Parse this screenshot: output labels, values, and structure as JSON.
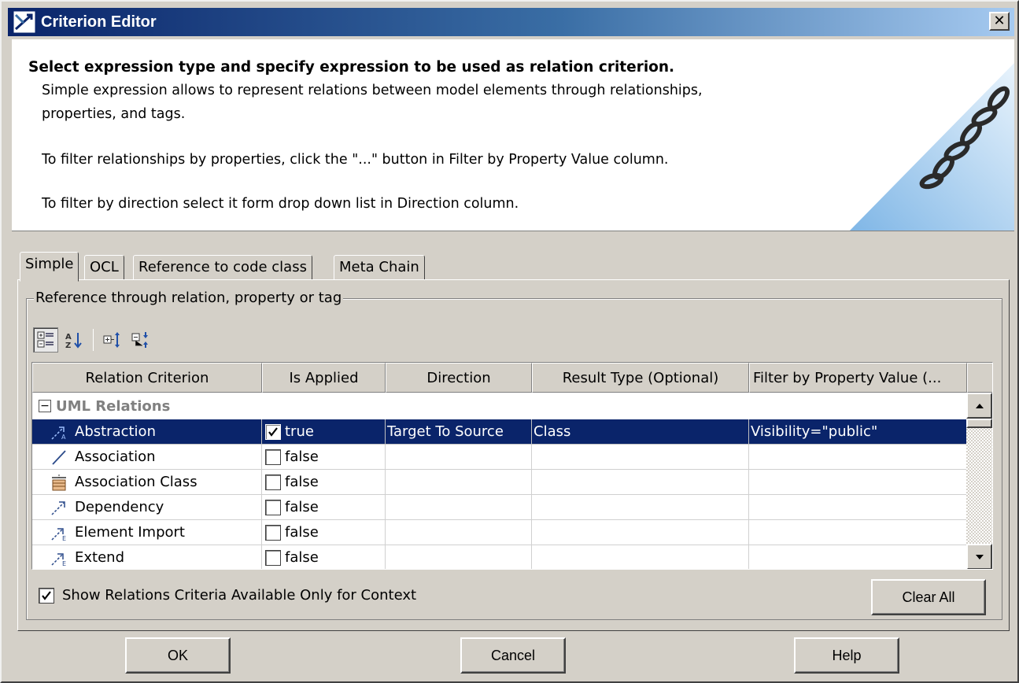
{
  "window": {
    "title": "Criterion Editor",
    "close_glyph": "✕"
  },
  "header": {
    "heading": "Select expression type and specify expression to be used as relation criterion.",
    "line1": "Simple expression allows to represent relations between model elements through relationships,",
    "line2": "properties, and tags.",
    "line3": "To filter relationships by properties, click the \"...\" button in Filter by Property Value column.",
    "line4": "To filter by direction select it form drop down list in Direction column.",
    "graphic": "chain-icon"
  },
  "tabs": [
    {
      "label": "Simple",
      "active": true
    },
    {
      "label": "OCL",
      "active": false
    },
    {
      "label": "Reference to code class",
      "active": false
    },
    {
      "label": "Meta Chain",
      "active": false
    }
  ],
  "group": {
    "legend": "Reference through relation, property or tag"
  },
  "toolbar": {
    "buttons": [
      "categorized-view-icon",
      "sort-alphabetically-icon",
      "expand-all-icon",
      "collapse-all-icon"
    ]
  },
  "table": {
    "columns": [
      "Relation Criterion",
      "Is Applied",
      "Direction",
      "Result Type (Optional)",
      "Filter by Property Value (..."
    ],
    "group_label": "UML Relations",
    "group_expander": "−",
    "rows": [
      {
        "name": "Abstraction",
        "icon": "abstraction-icon",
        "applied": "true",
        "checked": true,
        "direction": "Target To Source",
        "result_type": "Class",
        "filter": "Visibility=\"public\"",
        "selected": true
      },
      {
        "name": "Association",
        "icon": "association-icon",
        "applied": "false",
        "checked": false,
        "direction": "",
        "result_type": "",
        "filter": "",
        "selected": false
      },
      {
        "name": "Association Class",
        "icon": "association-class-icon",
        "applied": "false",
        "checked": false,
        "direction": "",
        "result_type": "",
        "filter": "",
        "selected": false
      },
      {
        "name": "Dependency",
        "icon": "dependency-icon",
        "applied": "false",
        "checked": false,
        "direction": "",
        "result_type": "",
        "filter": "",
        "selected": false
      },
      {
        "name": "Element Import",
        "icon": "element-import-icon",
        "applied": "false",
        "checked": false,
        "direction": "",
        "result_type": "",
        "filter": "",
        "selected": false
      },
      {
        "name": "Extend",
        "icon": "extend-icon",
        "applied": "false",
        "checked": false,
        "direction": "",
        "result_type": "",
        "filter": "",
        "selected": false
      }
    ]
  },
  "show_context_only": {
    "label": "Show Relations Criteria Available Only for Context",
    "checked": true
  },
  "buttons": {
    "clear_all": "Clear All",
    "ok": "OK",
    "cancel": "Cancel",
    "help": "Help"
  },
  "colors": {
    "selection": "#0a246a",
    "dialog_bg": "#d4d0c8"
  }
}
